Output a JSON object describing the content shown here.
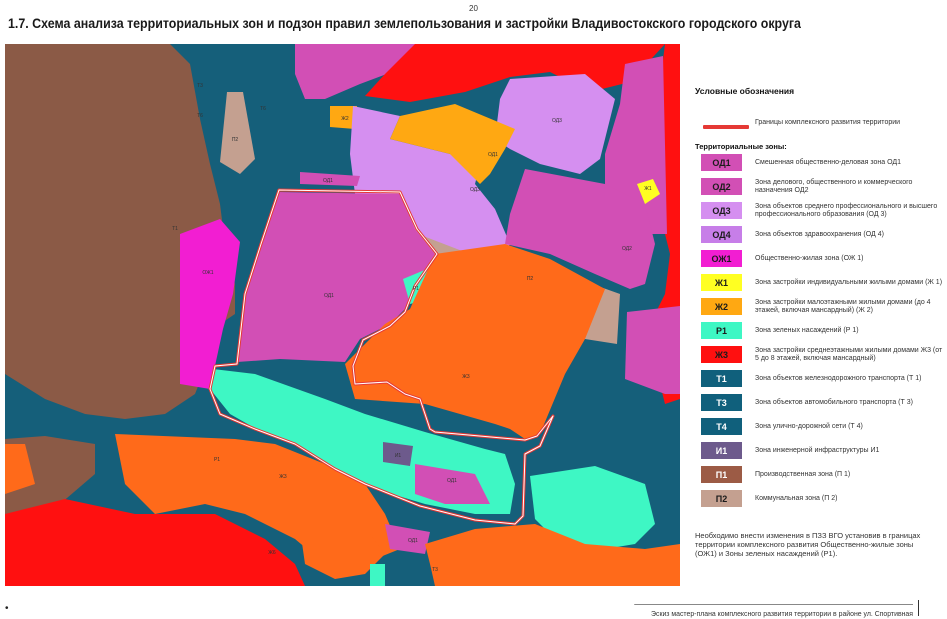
{
  "page_number": "20",
  "title": "1.7. Схема анализа территориальных зон и подзон правил землепользования и застройки Владивостокского городского округа",
  "legend": {
    "title": "Условные обозначения",
    "boundary": {
      "label": "Границы комплексного развития территории",
      "color": "#e53935"
    },
    "zones_title": "Территориальные зоны:",
    "items": [
      {
        "code": "ОД1",
        "label": "Смешенная общественно-деловая зона ОД1",
        "color": "#d24fb5"
      },
      {
        "code": "ОД2",
        "label": "Зона делового, общественного и коммерческого назначения ОД2",
        "color": "#d24fb5"
      },
      {
        "code": "ОД3",
        "label": "Зона объектов среднего профессионального и высшего профессионального образования (ОД 3)",
        "color": "#d58ff0"
      },
      {
        "code": "ОД4",
        "label": "Зона объектов здравоохранения (ОД 4)",
        "color": "#c77ee8"
      },
      {
        "code": "ОЖ1",
        "label": "Общественно-жилая зона (ОЖ 1)",
        "color": "#f21ed2"
      },
      {
        "code": "Ж1",
        "label": "Зона застройки индивидуальными жилыми домами (Ж 1)",
        "color": "#ffff22"
      },
      {
        "code": "Ж2",
        "label": "Зона застройки малоэтажными жилыми домами (до 4 этажей, включая мансардный) (Ж 2)",
        "color": "#ffa812"
      },
      {
        "code": "Р1",
        "label": "Зона зеленых насаждений (Р 1)",
        "color": "#3ef7c4"
      },
      {
        "code": "Ж3",
        "label": "Зона застройки среднеэтажными жилыми домами Ж3 (от 5 до 8 этажей, включая мансардный)",
        "color": "#ff1010"
      },
      {
        "code": "Т1",
        "label": "Зона объектов железнодорожного транспорта (Т 1)",
        "color": "#10607c"
      },
      {
        "code": "Т3",
        "label": "Зона объектов автомобильного транспорта (Т 3)",
        "color": "#10607c"
      },
      {
        "code": "Т4",
        "label": "Зона улично-дорожной сети (Т 4)",
        "color": "#10607c"
      },
      {
        "code": "И1",
        "label": "Зона инженерной инфраструктуры И1",
        "color": "#6d5a8c"
      },
      {
        "code": "П1",
        "label": "Производственная зона (П 1)",
        "color": "#9c5b45"
      },
      {
        "code": "П2",
        "label": "Коммунальная зона (П 2)",
        "color": "#c4a090"
      }
    ]
  },
  "note": "Необходимо внести изменения в ПЗЗ ВГО установив в границах территории комплексного развития Общественно-жилые зоны (ОЖ1) и Зоны зеленых насаждений (Р1).",
  "footer": "Эскиз мастер-плана комплексного развития территории в районе ул. Спортивная",
  "bullet": "•",
  "map": {
    "colors": {
      "road": "#155f7a",
      "p1": "#8b5a46",
      "p2": "#c4a090",
      "od1": "#d24fb5",
      "od3": "#d58ff0",
      "ozh1": "#f21ed2",
      "zh1": "#ffff22",
      "zh2": "#ffa812",
      "zh3": "#ff1010",
      "orange": "#ff6a1a",
      "r1": "#3ef7c4",
      "i1": "#6d5a8c",
      "boundary": "#e53935"
    },
    "zone_labels": {
      "t3a": "Т3",
      "t6a": "Т6",
      "t6b": "Т6",
      "p2a": "П2",
      "od3a": "ОД3",
      "zh2a": "Ж2",
      "od1a": "ОД1",
      "od3b": "ОД3",
      "od1b": "ОД1",
      "zh1a": "Ж1",
      "od2a": "ОД2",
      "ozh1a": "ОЖ1",
      "t1a": "Т1",
      "od1c": "ОД1",
      "r1a": "Р1",
      "p2b": "П2",
      "zh3a": "Ж3",
      "r1b": "Р1",
      "i1a": "И1",
      "od1d": "ОД1",
      "zh3b": "Ж3",
      "zh6": "Ж6",
      "od1e": "ОД1",
      "t3b": "Т3"
    }
  }
}
